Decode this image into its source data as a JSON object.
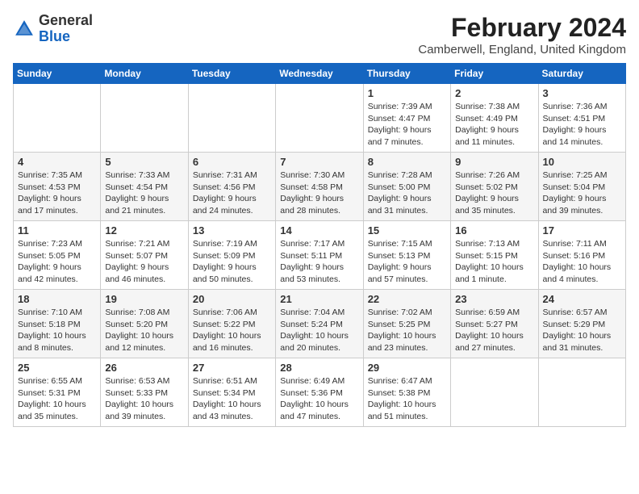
{
  "logo": {
    "text_general": "General",
    "text_blue": "Blue"
  },
  "header": {
    "month_title": "February 2024",
    "subtitle": "Camberwell, England, United Kingdom"
  },
  "weekdays": [
    "Sunday",
    "Monday",
    "Tuesday",
    "Wednesday",
    "Thursday",
    "Friday",
    "Saturday"
  ],
  "weeks": [
    [
      {
        "day": "",
        "info": ""
      },
      {
        "day": "",
        "info": ""
      },
      {
        "day": "",
        "info": ""
      },
      {
        "day": "",
        "info": ""
      },
      {
        "day": "1",
        "info": "Sunrise: 7:39 AM\nSunset: 4:47 PM\nDaylight: 9 hours\nand 7 minutes."
      },
      {
        "day": "2",
        "info": "Sunrise: 7:38 AM\nSunset: 4:49 PM\nDaylight: 9 hours\nand 11 minutes."
      },
      {
        "day": "3",
        "info": "Sunrise: 7:36 AM\nSunset: 4:51 PM\nDaylight: 9 hours\nand 14 minutes."
      }
    ],
    [
      {
        "day": "4",
        "info": "Sunrise: 7:35 AM\nSunset: 4:53 PM\nDaylight: 9 hours\nand 17 minutes."
      },
      {
        "day": "5",
        "info": "Sunrise: 7:33 AM\nSunset: 4:54 PM\nDaylight: 9 hours\nand 21 minutes."
      },
      {
        "day": "6",
        "info": "Sunrise: 7:31 AM\nSunset: 4:56 PM\nDaylight: 9 hours\nand 24 minutes."
      },
      {
        "day": "7",
        "info": "Sunrise: 7:30 AM\nSunset: 4:58 PM\nDaylight: 9 hours\nand 28 minutes."
      },
      {
        "day": "8",
        "info": "Sunrise: 7:28 AM\nSunset: 5:00 PM\nDaylight: 9 hours\nand 31 minutes."
      },
      {
        "day": "9",
        "info": "Sunrise: 7:26 AM\nSunset: 5:02 PM\nDaylight: 9 hours\nand 35 minutes."
      },
      {
        "day": "10",
        "info": "Sunrise: 7:25 AM\nSunset: 5:04 PM\nDaylight: 9 hours\nand 39 minutes."
      }
    ],
    [
      {
        "day": "11",
        "info": "Sunrise: 7:23 AM\nSunset: 5:05 PM\nDaylight: 9 hours\nand 42 minutes."
      },
      {
        "day": "12",
        "info": "Sunrise: 7:21 AM\nSunset: 5:07 PM\nDaylight: 9 hours\nand 46 minutes."
      },
      {
        "day": "13",
        "info": "Sunrise: 7:19 AM\nSunset: 5:09 PM\nDaylight: 9 hours\nand 50 minutes."
      },
      {
        "day": "14",
        "info": "Sunrise: 7:17 AM\nSunset: 5:11 PM\nDaylight: 9 hours\nand 53 minutes."
      },
      {
        "day": "15",
        "info": "Sunrise: 7:15 AM\nSunset: 5:13 PM\nDaylight: 9 hours\nand 57 minutes."
      },
      {
        "day": "16",
        "info": "Sunrise: 7:13 AM\nSunset: 5:15 PM\nDaylight: 10 hours\nand 1 minute."
      },
      {
        "day": "17",
        "info": "Sunrise: 7:11 AM\nSunset: 5:16 PM\nDaylight: 10 hours\nand 4 minutes."
      }
    ],
    [
      {
        "day": "18",
        "info": "Sunrise: 7:10 AM\nSunset: 5:18 PM\nDaylight: 10 hours\nand 8 minutes."
      },
      {
        "day": "19",
        "info": "Sunrise: 7:08 AM\nSunset: 5:20 PM\nDaylight: 10 hours\nand 12 minutes."
      },
      {
        "day": "20",
        "info": "Sunrise: 7:06 AM\nSunset: 5:22 PM\nDaylight: 10 hours\nand 16 minutes."
      },
      {
        "day": "21",
        "info": "Sunrise: 7:04 AM\nSunset: 5:24 PM\nDaylight: 10 hours\nand 20 minutes."
      },
      {
        "day": "22",
        "info": "Sunrise: 7:02 AM\nSunset: 5:25 PM\nDaylight: 10 hours\nand 23 minutes."
      },
      {
        "day": "23",
        "info": "Sunrise: 6:59 AM\nSunset: 5:27 PM\nDaylight: 10 hours\nand 27 minutes."
      },
      {
        "day": "24",
        "info": "Sunrise: 6:57 AM\nSunset: 5:29 PM\nDaylight: 10 hours\nand 31 minutes."
      }
    ],
    [
      {
        "day": "25",
        "info": "Sunrise: 6:55 AM\nSunset: 5:31 PM\nDaylight: 10 hours\nand 35 minutes."
      },
      {
        "day": "26",
        "info": "Sunrise: 6:53 AM\nSunset: 5:33 PM\nDaylight: 10 hours\nand 39 minutes."
      },
      {
        "day": "27",
        "info": "Sunrise: 6:51 AM\nSunset: 5:34 PM\nDaylight: 10 hours\nand 43 minutes."
      },
      {
        "day": "28",
        "info": "Sunrise: 6:49 AM\nSunset: 5:36 PM\nDaylight: 10 hours\nand 47 minutes."
      },
      {
        "day": "29",
        "info": "Sunrise: 6:47 AM\nSunset: 5:38 PM\nDaylight: 10 hours\nand 51 minutes."
      },
      {
        "day": "",
        "info": ""
      },
      {
        "day": "",
        "info": ""
      }
    ]
  ]
}
